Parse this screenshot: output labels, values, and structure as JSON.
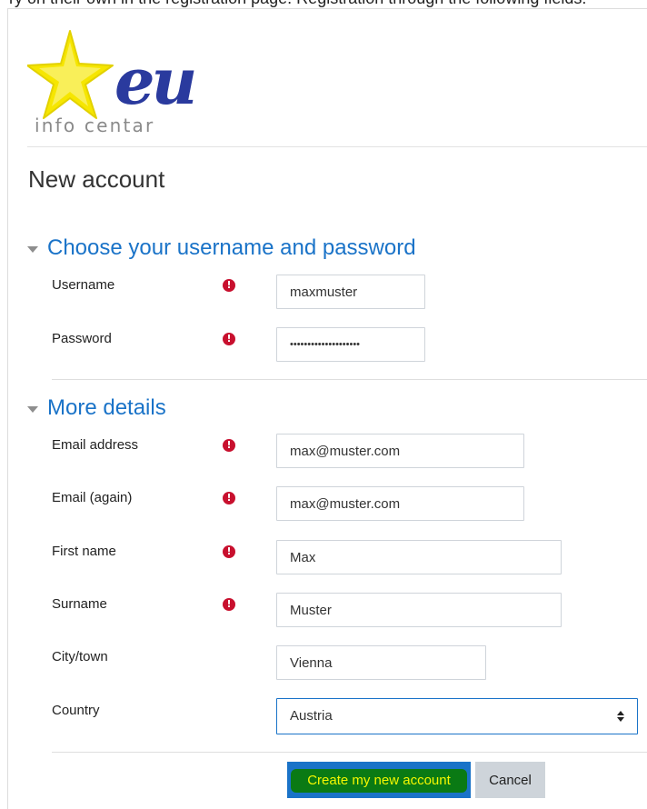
{
  "caption": "ry on their own in the registration page. Registration through the following fields:",
  "logo": {
    "text": "info centar",
    "colors": {
      "star": "#f6e600",
      "star_outline": "#e2d100",
      "letters": "#2a3a9e"
    }
  },
  "page": {
    "title": "New account"
  },
  "sections": {
    "credentials": {
      "title": "Choose your username and password"
    },
    "details": {
      "title": "More details"
    }
  },
  "fields": {
    "username": {
      "label": "Username",
      "value": "maxmuster",
      "required": true
    },
    "password": {
      "label": "Password",
      "value": "••••••••••••••••••••",
      "required": true
    },
    "email": {
      "label": "Email address",
      "value": "max@muster.com",
      "required": true
    },
    "email2": {
      "label": "Email (again)",
      "value": "max@muster.com",
      "required": true
    },
    "firstname": {
      "label": "First name",
      "value": "Max",
      "required": true
    },
    "surname": {
      "label": "Surname",
      "value": "Muster",
      "required": true
    },
    "city": {
      "label": "City/town",
      "value": "Vienna",
      "required": false
    },
    "country": {
      "label": "Country",
      "value": "Austria",
      "required": false
    }
  },
  "required_icon": "!",
  "buttons": {
    "submit": "Create my new account",
    "cancel": "Cancel"
  },
  "colors": {
    "accent": "#1a73c8",
    "required": "#c8102e",
    "highlight": "#0a7a14",
    "highlight_text": "#f4f700"
  }
}
